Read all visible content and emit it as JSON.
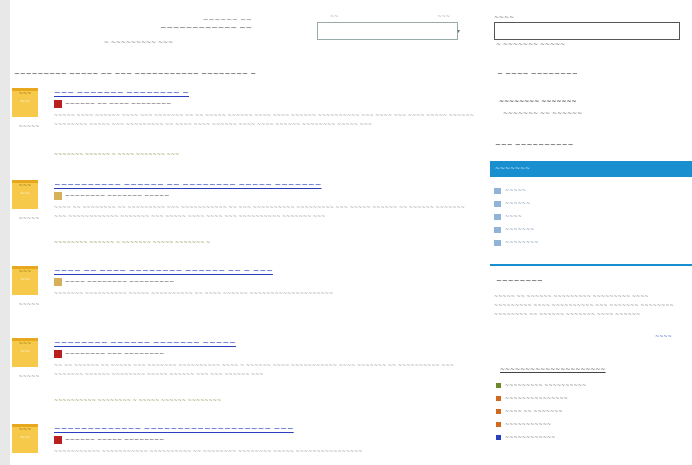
{
  "header": {
    "logo_line1": "~~~~~~ ~~",
    "logo_line2": "~~~~~~~~~~~~ ~~",
    "subline": "~ ~~~~~~~~~ ~~~",
    "search_label_left": "~~",
    "search_label_right": "~~~",
    "search_arrow": "▾",
    "search_value": ""
  },
  "section_title": "~~~~~~~~~ ~~~~~ ~~ ~~~ ~~~~~~~~~~~ ~~~~~~~~ ~",
  "stories": [
    {
      "date_top": "~~~",
      "date_day": "~~",
      "side_meta": "~~~~~",
      "title": "~~~ ~~~~~~~ ~~~~~~~~ ~",
      "author": "~~~~~~ ~~ ~~~~ ~~~~~~~~",
      "body": "~~~~~ ~~~~ ~~~~~~ ~~~~ ~~~ ~~~~~~~ ~~ ~~ ~~~~~ ~~~~~~ ~~~~ ~~~~ ~~~~~~ ~~~~~~~~~~ ~~~ ~~~~ ~~~ ~~~~ ~~~~~ ~~~~~~ ~~~~~~~~ ~~~~~ ~~~ ~~~~~~~~~ ~~ ~~~~ ~~~~ ~~~~~~ ~~~~ ~~~~ ~~~~~~ ~~~~~~~~ ~~~~~ ~~~",
      "links": "~~~~~~~ ~~~~~~ ~ ~~~~ ~~~~~~~ ~~~"
    },
    {
      "date_top": "~~~",
      "date_day": "~~",
      "side_meta": "~~~~~",
      "title": "~~~~~~~~~~ ~~~~~~ ~~ ~~~~~~~~ ~~~~~ ~~~~~~~",
      "author": "~~~~~~~~ ~~~~~~~ ~~~~~",
      "body": "~~~~ ~~ ~~~~~~~~ ~~ ~~~~~~~~~ ~~~ ~~~~~~~~~~~ ~~ ~~~ ~~~~~~~~~~ ~~~~~~~~~ ~~~ ~~~~~ ~~~~~~ ~~ ~~~~~~ ~~~~~~~ ~~~ ~~~~~~~~~~~~ ~~~~~~~ ~~~ ~~~~~ ~~~~ ~~~~ ~~~ ~~~~~~~~~~ ~~~~~~~ ~~~",
      "links": "~~~~~~~~ ~~~~~~ ~ ~~~~~~~ ~~~~~ ~~~~~~~ ~"
    },
    {
      "date_top": "~~~",
      "date_day": "~~",
      "side_meta": "~~~~~",
      "title": "~~~~ ~~ ~~~~ ~~~~~~~~ ~~~~~~ ~~ ~ ~~~",
      "author": "~~~~ ~~~~~~~~ ~~~~~~~~~",
      "body": "~~~~~~~ ~~~~~~~~~~ ~~~~~ ~~~~~~~~~~ ~~ ~~~~ ~~~~~~ ~~~~~~~~~~~~~~~~~~~~",
      "links": ""
    },
    {
      "date_top": "~~~",
      "date_day": "~~",
      "side_meta": "~~~~~",
      "title": "~~~~~~~~ ~~~~~~ ~~~~~~~ ~~~~~",
      "author": "~~~~~~~~ ~~~ ~~~~~~~~",
      "body": "~~ ~~ ~~~~~~ ~~ ~~~~~ ~~~ ~~~~~~~ ~~~~~~~~~~ ~~~~ ~ ~~~~~~ ~~~~ ~~~~~~~~~~~ ~~~~ ~~~~~~~ ~~ ~~~~~~~~~~ ~~~ ~~~~~~~ ~~~~~~ ~~~~~~~~ ~~~~~ ~~~~~~ ~~~ ~~~ ~~~~~~ ~~~",
      "links": "~~~~~~~~~~ ~~~~~~~~ ~ ~~~~~ ~~~~~~ ~~~~~~~~"
    },
    {
      "date_top": "~~~",
      "date_day": "~~",
      "side_meta": "~~~~~",
      "title": "~~~~~~~~~~~~~ ~~~~~~~~~~~~~~~~~~~ ~~~",
      "author": "~~~~~~ ~~~~~ ~~~~~~~~",
      "body": "~~~~~~~~~~~ ~~~~~~~~~~~ ~~~~~~~~~~ ~~ ~~~~~~~~ ~~~~~~~~ ~~~~~ ~~~~~~~~~~~~~~~~",
      "links": ""
    }
  ],
  "sidebar": {
    "search_label": "~~~~",
    "search_value": "",
    "search_hint": "~ ~~~~~~~ ~~~~~",
    "block1_head": "~ ~~~~ ~~~~~~~~",
    "block1_strong": "~~~~~~~~ ~~~~~~~",
    "block1_sub": "~~~~~~~ ~~ ~~~~~~",
    "block2_head": "~~~ ~~~~~~~~~~",
    "bar_label": "~~~~~~~",
    "list": [
      "~~~~~",
      "~~~~~~",
      "~~~~",
      "~~~~~~~",
      "~~~~~~~~"
    ],
    "block3_head": "~~~~~~~~",
    "para": "~~~~~ ~~ ~~~~~~ ~~~~~~~~~ ~~~~~~~~~ ~~~~ ~~~~~~~~~ ~~~~ ~~~~~~~~~~ ~~~ ~~~~~~~ ~~~~~~~~ ~~~~~~~~ ~~ ~~~~~~ ~~~~~~~ ~~~~ ~~~~~~",
    "more": "~~~~",
    "links_head": "~~~~~~~~~~~~~~~~~~~~~",
    "links": [
      {
        "label": "~~~~~~~~~ ~~~~~~~~~~",
        "color": "#6b8a2a"
      },
      {
        "label": "~~~~~~~~~~~~~~~",
        "color": "#d2691e"
      },
      {
        "label": "~~~~ ~~ ~~~~~~~",
        "color": "#d2691e"
      },
      {
        "label": "~~~~~~~~~~~",
        "color": "#d2691e"
      },
      {
        "label": "~~~~~~~~~~~~",
        "color": "#2a3fbf"
      }
    ]
  },
  "colors": {
    "accent": "#1a8fd0",
    "date_box": "#f6c94a",
    "link": "#2a3fbf"
  }
}
